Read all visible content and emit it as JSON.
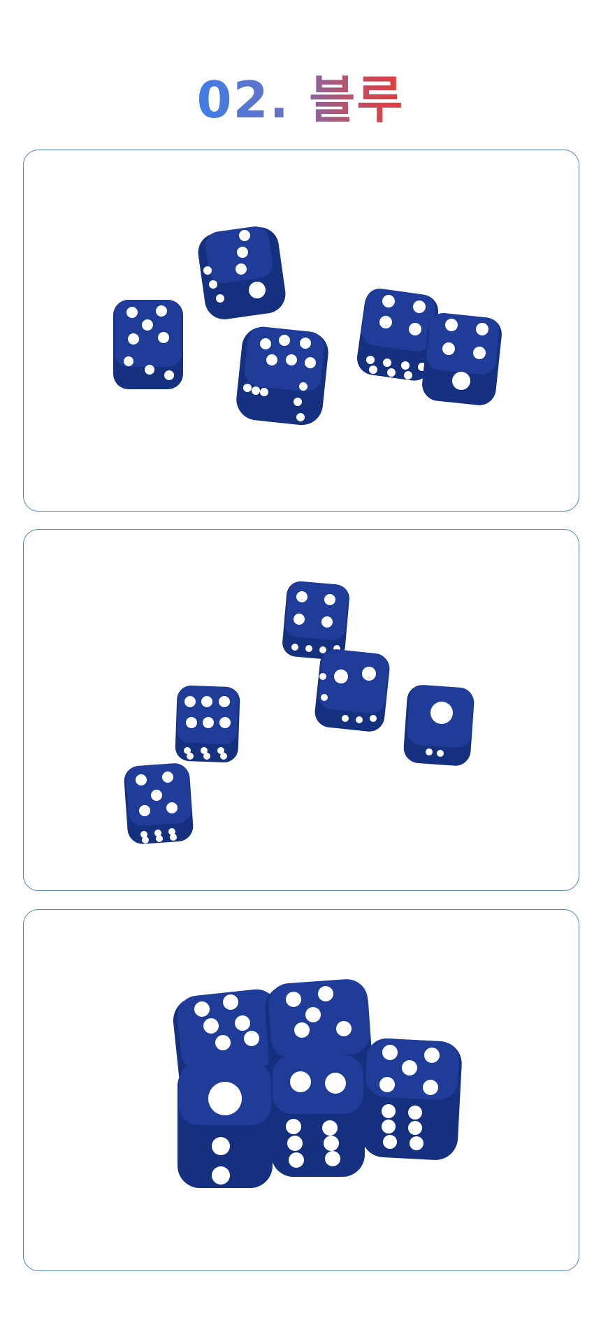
{
  "page": {
    "title": "02. 블루"
  },
  "panels": [
    {
      "name": "dice-photo-scattered"
    },
    {
      "name": "dice-photo-spread"
    },
    {
      "name": "dice-photo-cluster"
    }
  ],
  "colors": {
    "title_gradient_start": "#3f7fe6",
    "title_gradient_end": "#e83a3a",
    "panel_border": "#4f86c6",
    "dice_blue": "#1f3d98",
    "pip_white": "#ffffff"
  }
}
